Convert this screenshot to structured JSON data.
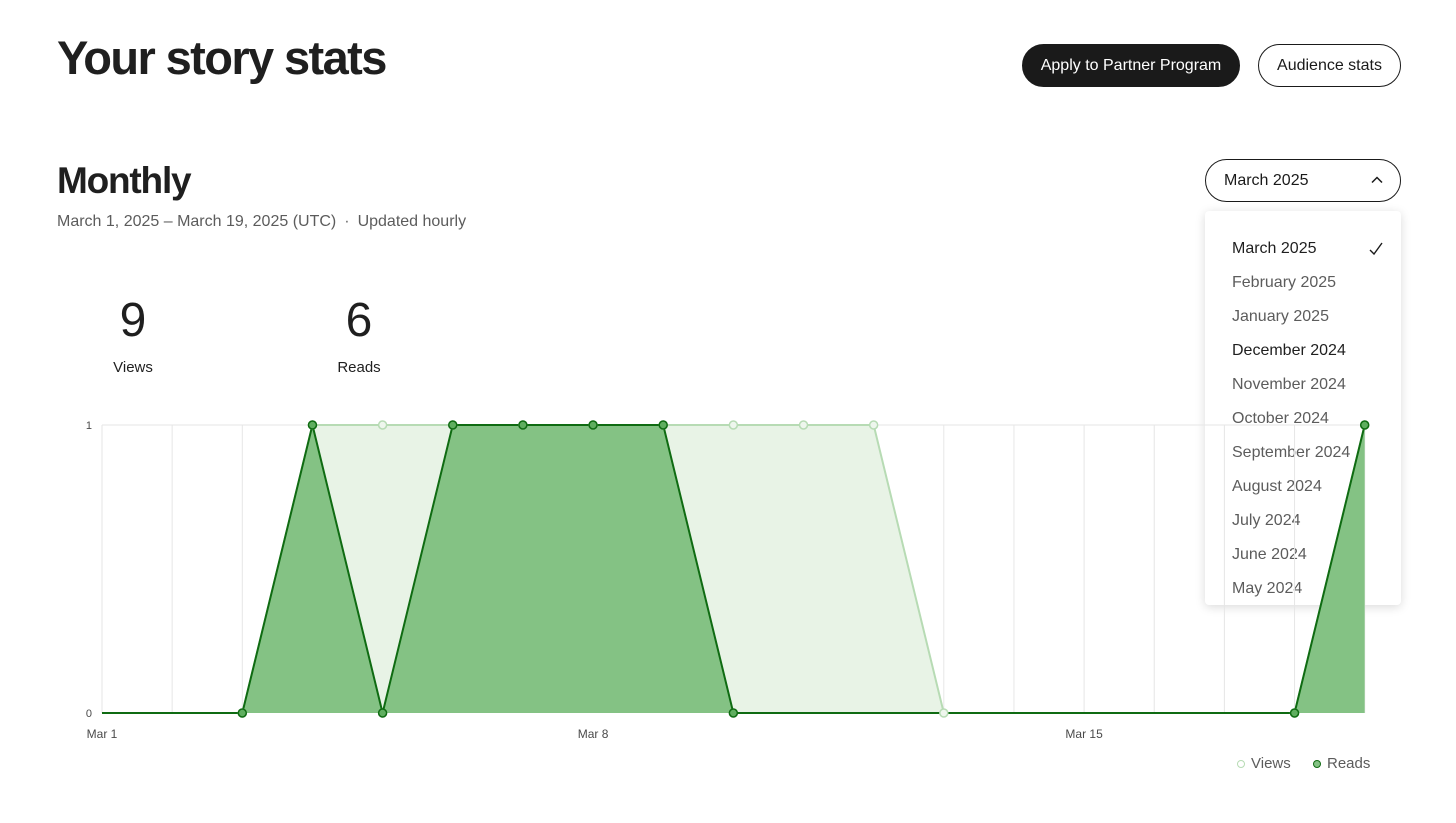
{
  "header": {
    "title": "Your story stats",
    "partner_button": "Apply to Partner Program",
    "audience_button": "Audience stats"
  },
  "section": {
    "title": "Monthly",
    "date_range": "March 1, 2025 – March 19, 2025 (UTC)",
    "separator": "·",
    "update_note": "Updated hourly"
  },
  "month_select": {
    "selected": "March 2025",
    "options": [
      "March 2025",
      "February 2025",
      "January 2025",
      "December 2024",
      "November 2024",
      "October 2024",
      "September 2024",
      "August 2024",
      "July 2024",
      "June 2024",
      "May 2024"
    ]
  },
  "stats": {
    "views": {
      "value": "9",
      "label": "Views"
    },
    "reads": {
      "value": "6",
      "label": "Reads"
    }
  },
  "colors": {
    "views_line": "#b7dbb4",
    "views_fill": "#e8f3e6",
    "reads_line": "#0f6b12",
    "reads_fill": "#84c284",
    "grid": "#e6e6e6"
  },
  "chart_data": {
    "type": "area",
    "x": [
      "Mar 1",
      "Mar 2",
      "Mar 3",
      "Mar 4",
      "Mar 5",
      "Mar 6",
      "Mar 7",
      "Mar 8",
      "Mar 9",
      "Mar 10",
      "Mar 11",
      "Mar 12",
      "Mar 13",
      "Mar 14",
      "Mar 15",
      "Mar 16",
      "Mar 17",
      "Mar 18",
      "Mar 19"
    ],
    "x_tick_labels": [
      "Mar 1",
      "Mar 8",
      "Mar 15"
    ],
    "y_tick_labels": [
      "0",
      "1"
    ],
    "ylim": [
      0,
      1
    ],
    "grid": true,
    "legend": "bottom-right",
    "series": [
      {
        "name": "Views",
        "values": [
          0,
          0,
          0,
          1,
          1,
          1,
          1,
          1,
          1,
          1,
          1,
          1,
          0,
          0,
          0,
          0,
          0,
          0,
          1
        ]
      },
      {
        "name": "Reads",
        "values": [
          0,
          0,
          0,
          1,
          0,
          1,
          1,
          1,
          1,
          0,
          0,
          0,
          0,
          0,
          0,
          0,
          0,
          0,
          1
        ]
      }
    ]
  },
  "legend": {
    "views": "Views",
    "reads": "Reads"
  }
}
